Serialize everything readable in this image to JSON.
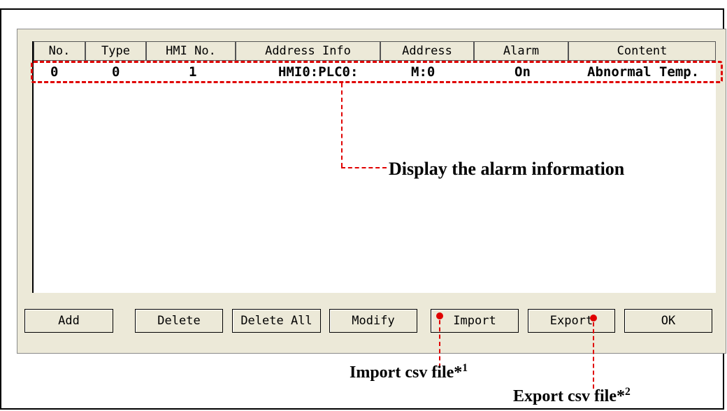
{
  "table": {
    "headers": {
      "no": "No.",
      "type": "Type",
      "hmi_no": "HMI No.",
      "address_info": "Address Info",
      "address": "Address",
      "alarm": "Alarm",
      "content": "Content"
    },
    "rows": [
      {
        "no": "0",
        "type": "0",
        "hmi_no": "1",
        "address_info": "HMI0:PLC0:",
        "address": "M:0",
        "alarm": "On",
        "content": "Abnormal Temp."
      }
    ]
  },
  "buttons": {
    "add": "Add",
    "delete": "Delete",
    "delete_all": "Delete All",
    "modify": "Modify",
    "import": "Import",
    "export": "Export",
    "ok": "OK"
  },
  "annotations": {
    "display_alarm": "Display the alarm information",
    "import_csv": "Import csv file*",
    "import_csv_note": "1",
    "export_csv": "Export csv file*",
    "export_csv_note": "2"
  },
  "colors": {
    "annotation_red": "#e00000",
    "panel_bg": "#ece9d8"
  }
}
